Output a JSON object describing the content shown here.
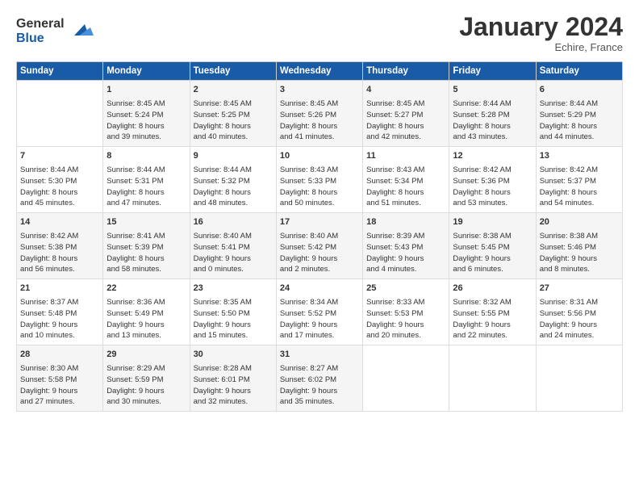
{
  "header": {
    "logo_line1": "General",
    "logo_line2": "Blue",
    "month_title": "January 2024",
    "location": "Echire, France"
  },
  "weekdays": [
    "Sunday",
    "Monday",
    "Tuesday",
    "Wednesday",
    "Thursday",
    "Friday",
    "Saturday"
  ],
  "rows": [
    [
      {
        "day": "",
        "info": ""
      },
      {
        "day": "1",
        "info": "Sunrise: 8:45 AM\nSunset: 5:24 PM\nDaylight: 8 hours\nand 39 minutes."
      },
      {
        "day": "2",
        "info": "Sunrise: 8:45 AM\nSunset: 5:25 PM\nDaylight: 8 hours\nand 40 minutes."
      },
      {
        "day": "3",
        "info": "Sunrise: 8:45 AM\nSunset: 5:26 PM\nDaylight: 8 hours\nand 41 minutes."
      },
      {
        "day": "4",
        "info": "Sunrise: 8:45 AM\nSunset: 5:27 PM\nDaylight: 8 hours\nand 42 minutes."
      },
      {
        "day": "5",
        "info": "Sunrise: 8:44 AM\nSunset: 5:28 PM\nDaylight: 8 hours\nand 43 minutes."
      },
      {
        "day": "6",
        "info": "Sunrise: 8:44 AM\nSunset: 5:29 PM\nDaylight: 8 hours\nand 44 minutes."
      }
    ],
    [
      {
        "day": "7",
        "info": "Sunrise: 8:44 AM\nSunset: 5:30 PM\nDaylight: 8 hours\nand 45 minutes."
      },
      {
        "day": "8",
        "info": "Sunrise: 8:44 AM\nSunset: 5:31 PM\nDaylight: 8 hours\nand 47 minutes."
      },
      {
        "day": "9",
        "info": "Sunrise: 8:44 AM\nSunset: 5:32 PM\nDaylight: 8 hours\nand 48 minutes."
      },
      {
        "day": "10",
        "info": "Sunrise: 8:43 AM\nSunset: 5:33 PM\nDaylight: 8 hours\nand 50 minutes."
      },
      {
        "day": "11",
        "info": "Sunrise: 8:43 AM\nSunset: 5:34 PM\nDaylight: 8 hours\nand 51 minutes."
      },
      {
        "day": "12",
        "info": "Sunrise: 8:42 AM\nSunset: 5:36 PM\nDaylight: 8 hours\nand 53 minutes."
      },
      {
        "day": "13",
        "info": "Sunrise: 8:42 AM\nSunset: 5:37 PM\nDaylight: 8 hours\nand 54 minutes."
      }
    ],
    [
      {
        "day": "14",
        "info": "Sunrise: 8:42 AM\nSunset: 5:38 PM\nDaylight: 8 hours\nand 56 minutes."
      },
      {
        "day": "15",
        "info": "Sunrise: 8:41 AM\nSunset: 5:39 PM\nDaylight: 8 hours\nand 58 minutes."
      },
      {
        "day": "16",
        "info": "Sunrise: 8:40 AM\nSunset: 5:41 PM\nDaylight: 9 hours\nand 0 minutes."
      },
      {
        "day": "17",
        "info": "Sunrise: 8:40 AM\nSunset: 5:42 PM\nDaylight: 9 hours\nand 2 minutes."
      },
      {
        "day": "18",
        "info": "Sunrise: 8:39 AM\nSunset: 5:43 PM\nDaylight: 9 hours\nand 4 minutes."
      },
      {
        "day": "19",
        "info": "Sunrise: 8:38 AM\nSunset: 5:45 PM\nDaylight: 9 hours\nand 6 minutes."
      },
      {
        "day": "20",
        "info": "Sunrise: 8:38 AM\nSunset: 5:46 PM\nDaylight: 9 hours\nand 8 minutes."
      }
    ],
    [
      {
        "day": "21",
        "info": "Sunrise: 8:37 AM\nSunset: 5:48 PM\nDaylight: 9 hours\nand 10 minutes."
      },
      {
        "day": "22",
        "info": "Sunrise: 8:36 AM\nSunset: 5:49 PM\nDaylight: 9 hours\nand 13 minutes."
      },
      {
        "day": "23",
        "info": "Sunrise: 8:35 AM\nSunset: 5:50 PM\nDaylight: 9 hours\nand 15 minutes."
      },
      {
        "day": "24",
        "info": "Sunrise: 8:34 AM\nSunset: 5:52 PM\nDaylight: 9 hours\nand 17 minutes."
      },
      {
        "day": "25",
        "info": "Sunrise: 8:33 AM\nSunset: 5:53 PM\nDaylight: 9 hours\nand 20 minutes."
      },
      {
        "day": "26",
        "info": "Sunrise: 8:32 AM\nSunset: 5:55 PM\nDaylight: 9 hours\nand 22 minutes."
      },
      {
        "day": "27",
        "info": "Sunrise: 8:31 AM\nSunset: 5:56 PM\nDaylight: 9 hours\nand 24 minutes."
      }
    ],
    [
      {
        "day": "28",
        "info": "Sunrise: 8:30 AM\nSunset: 5:58 PM\nDaylight: 9 hours\nand 27 minutes."
      },
      {
        "day": "29",
        "info": "Sunrise: 8:29 AM\nSunset: 5:59 PM\nDaylight: 9 hours\nand 30 minutes."
      },
      {
        "day": "30",
        "info": "Sunrise: 8:28 AM\nSunset: 6:01 PM\nDaylight: 9 hours\nand 32 minutes."
      },
      {
        "day": "31",
        "info": "Sunrise: 8:27 AM\nSunset: 6:02 PM\nDaylight: 9 hours\nand 35 minutes."
      },
      {
        "day": "",
        "info": ""
      },
      {
        "day": "",
        "info": ""
      },
      {
        "day": "",
        "info": ""
      }
    ]
  ]
}
